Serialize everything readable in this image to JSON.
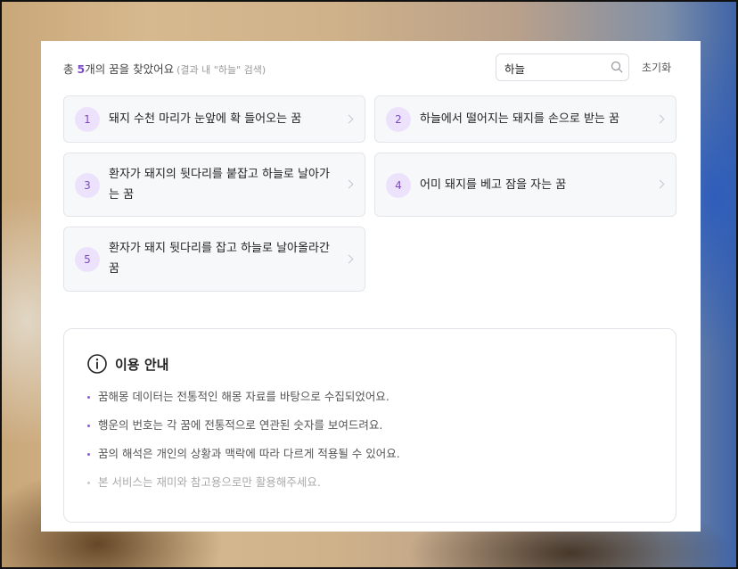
{
  "summary": {
    "prefix": "총 ",
    "count": "5",
    "suffix": "개의 꿈을 찾았어요",
    "note": "(결과 내 \"하늘\" 검색)"
  },
  "search": {
    "value": "하늘",
    "icon": "search-icon"
  },
  "reset_label": "초기화",
  "results": [
    {
      "number": "1",
      "title": "돼지 수천 마리가 눈앞에 확 들어오는 꿈"
    },
    {
      "number": "2",
      "title": "하늘에서 떨어지는 돼지를 손으로 받는 꿈"
    },
    {
      "number": "3",
      "title": "환자가 돼지의 뒷다리를 붙잡고 하늘로 날아가는 꿈"
    },
    {
      "number": "4",
      "title": "어미 돼지를 베고 잠을 자는 꿈"
    },
    {
      "number": "5",
      "title": "환자가 돼지 뒷다리를 잡고 하늘로 날아올라간 꿈"
    }
  ],
  "guide": {
    "title": "이용 안내",
    "icon": "info-icon",
    "items": [
      "꿈해몽 데이터는 전통적인 해몽 자료를 바탕으로 수집되었어요.",
      "행운의 번호는 각 꿈에 전통적으로 연관된 숫자를 보여드려요.",
      "꿈의 해석은 개인의 상황과 맥락에 따라 다르게 적용될 수 있어요.",
      "본 서비스는 재미와 참고용으로만 활용해주세요."
    ]
  },
  "colors": {
    "accent": "#7d4cc4",
    "badge_bg": "#ede2fb",
    "card_bg": "#f7f8fa"
  }
}
